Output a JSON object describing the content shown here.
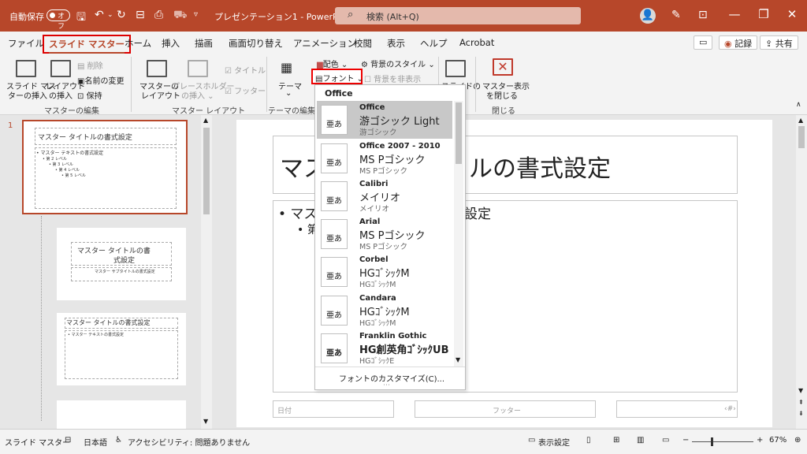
{
  "titlebar": {
    "autosave_label": "自動保存",
    "autosave_state": "オフ",
    "filename": "プレゼンテーション1 - PowerPoint",
    "search_placeholder": "検索 (Alt+Q)",
    "accent": "#b7472a"
  },
  "menu": {
    "tabs": [
      "ファイル",
      "スライド マスター",
      "ホーム",
      "挿入",
      "描画",
      "画面切り替え",
      "アニメーション",
      "校閲",
      "表示",
      "ヘルプ",
      "Acrobat"
    ],
    "record": "記録",
    "share": "共有"
  },
  "ribbon": {
    "insert_master": [
      "スライド マス",
      "ターの挿入"
    ],
    "insert_layout": [
      "レイアウト",
      "の挿入"
    ],
    "delete": "削除",
    "rename": "名前の変更",
    "preserve": "保持",
    "group_edit_master": "マスターの編集",
    "master_layout": [
      "マスターの",
      "レイアウト"
    ],
    "insert_placeholder": [
      "プレースホルダー",
      "の挿入 ⌄"
    ],
    "title_check": "タイトル",
    "footer_check": "フッター",
    "group_master_layout": "マスター レイアウト",
    "theme": "テーマ",
    "group_edit_theme": "テーマの編集",
    "colors": "配色 ⌄",
    "fonts": "フォント ⌄",
    "bg_styles": "背景のスタイル ⌄",
    "hide_bg": "背景を非表示",
    "slide_size": "スライドの",
    "close_master": [
      "マスター表示",
      "を閉じる"
    ],
    "group_close": "閉じる"
  },
  "font_menu": {
    "header": "Office",
    "items": [
      {
        "name": "Office",
        "major": "游ゴシック Light",
        "minor": "游ゴシック",
        "preview": "亜あ"
      },
      {
        "name": "Office 2007 - 2010",
        "major": "MS Pゴシック",
        "minor": "MS Pゴシック",
        "preview": "亜あ"
      },
      {
        "name": "Calibri",
        "major": "メイリオ",
        "minor": "メイリオ",
        "preview": "亜あ"
      },
      {
        "name": "Arial",
        "major": "MS Pゴシック",
        "minor": "MS Pゴシック",
        "preview": "亜あ"
      },
      {
        "name": "Corbel",
        "major": "HGｺﾞｼｯｸM",
        "minor": "HGｺﾞｼｯｸM",
        "preview": "亜あ"
      },
      {
        "name": "Candara",
        "major": "HGｺﾞｼｯｸM",
        "minor": "HGｺﾞｼｯｸM",
        "preview": "亜あ"
      },
      {
        "name": "Franklin Gothic",
        "major": "HG創英角ｺﾞｼｯｸUB",
        "minor": "HGｺﾞｼｯｸE",
        "preview": "亜あ"
      }
    ],
    "customize": "フォントのカスタマイズ(C)..."
  },
  "thumbs": {
    "slide_number": "1",
    "master_title": "マスター タイトルの書式設定",
    "master_text": "• マスター テキストの書式設定",
    "level2": "• 第 2 レベル",
    "level3": "• 第 3 レベル",
    "level4": "• 第 4 レベル",
    "level5": "• 第 5 レベル",
    "layout2_title": [
      "マスター タイトルの書",
      "式設定"
    ],
    "layout2_sub": "マスター サブタイトルの書式設定",
    "layout3_title": "マスター タイトルの書式設定"
  },
  "slide": {
    "title_left": "マス",
    "title_right": "ルの書式設定",
    "body_left": "• マス",
    "body_right": "設定",
    "level2_left": "• 第",
    "date": "日付",
    "footer": "フッター",
    "page": "‹#›"
  },
  "status": {
    "mode": "スライド マスター",
    "language": "日本語",
    "accessibility": "アクセシビリティ: 問題ありません",
    "display_settings": "表示設定",
    "zoom": "67%"
  }
}
